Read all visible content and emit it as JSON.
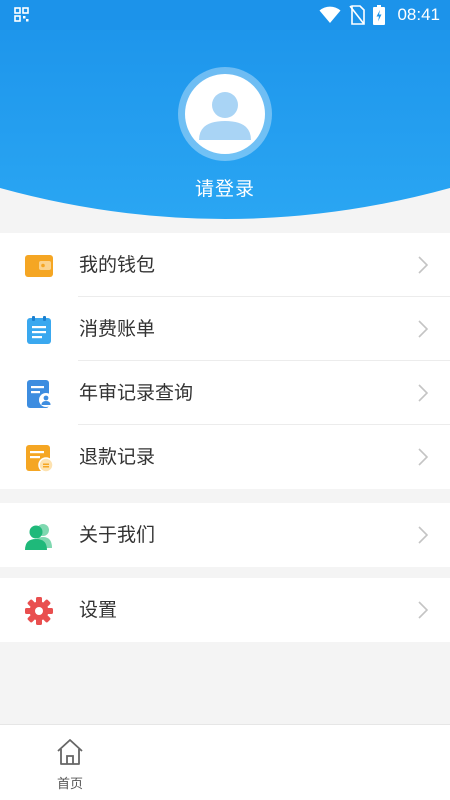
{
  "status_bar": {
    "time": "08:41",
    "icons": [
      "app-grid-icon",
      "wifi-icon",
      "no-sim-icon",
      "battery-charging-icon"
    ]
  },
  "header": {
    "login_text": "请登录",
    "avatar_icon": "user-avatar-icon",
    "background_color": "#1c93ea"
  },
  "menu": {
    "main_items": [
      {
        "label": "我的钱包",
        "icon": "wallet-icon",
        "color": "#f5a623"
      },
      {
        "label": "消费账单",
        "icon": "bill-icon",
        "color": "#3aa8ef"
      },
      {
        "label": "年审记录查询",
        "icon": "inspection-record-icon",
        "color": "#3d8de0"
      },
      {
        "label": "退款记录",
        "icon": "refund-record-icon",
        "color": "#f5a623"
      }
    ],
    "about": {
      "label": "关于我们",
      "icon": "users-icon",
      "color": "#1fb97a"
    },
    "settings": {
      "label": "设置",
      "icon": "gear-icon",
      "color": "#e94f4f"
    }
  },
  "bottom_nav": {
    "home_label": "首页",
    "home_icon": "home-icon"
  }
}
